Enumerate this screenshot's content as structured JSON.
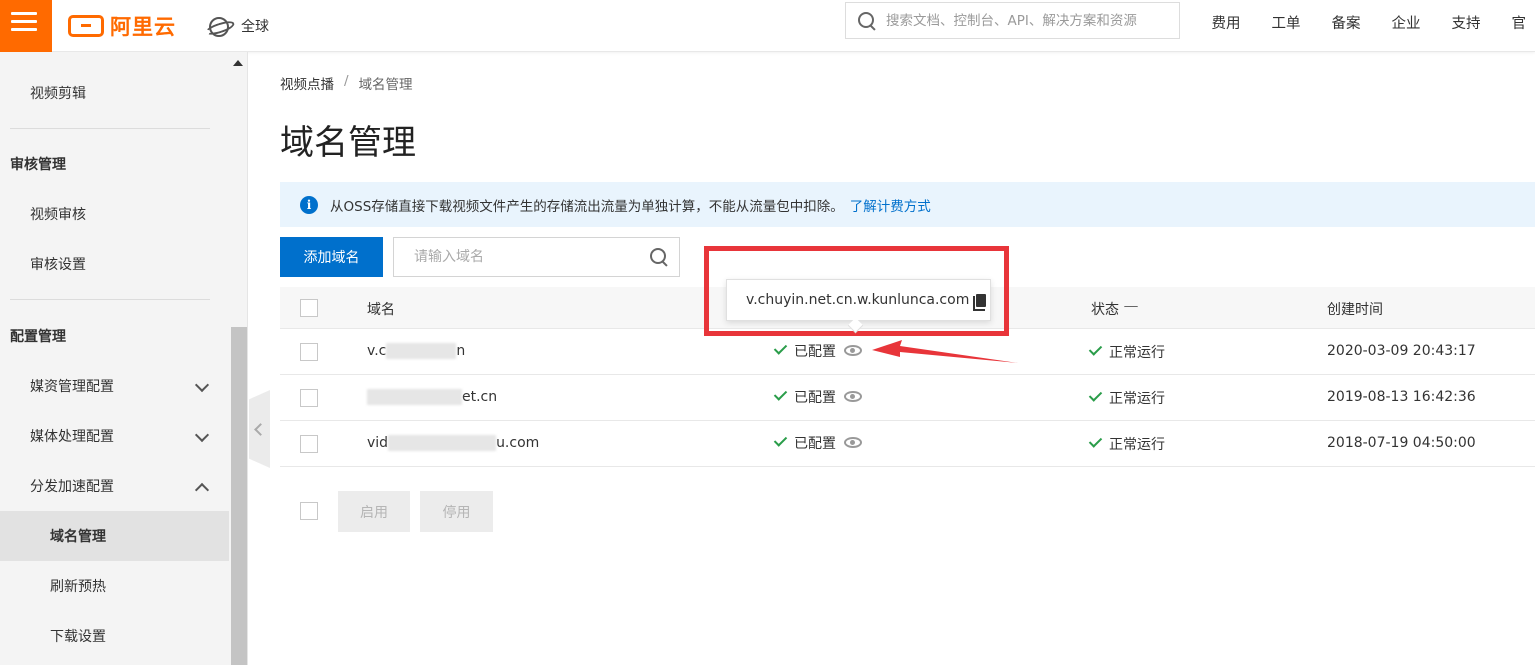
{
  "header": {
    "logo_text": "阿里云",
    "region": "全球",
    "search_placeholder": "搜索文档、控制台、API、解决方案和资源",
    "nav": [
      "费用",
      "工单",
      "备案",
      "企业",
      "支持",
      "官"
    ]
  },
  "sidebar": {
    "items": [
      {
        "label": "视频剪辑",
        "level": 1
      },
      {
        "label": "审核管理",
        "level": 0
      },
      {
        "label": "视频审核",
        "level": 1
      },
      {
        "label": "审核设置",
        "level": 1
      },
      {
        "label": "配置管理",
        "level": 0
      },
      {
        "label": "媒资管理配置",
        "level": 1,
        "expanded": false
      },
      {
        "label": "媒体处理配置",
        "level": 1,
        "expanded": false
      },
      {
        "label": "分发加速配置",
        "level": 1,
        "expanded": true
      },
      {
        "label": "域名管理",
        "level": 2,
        "active": true
      },
      {
        "label": "刷新预热",
        "level": 2
      },
      {
        "label": "下载设置",
        "level": 2
      }
    ]
  },
  "breadcrumb": {
    "parent": "视频点播",
    "separator": "/",
    "current": "域名管理"
  },
  "page_title": "域名管理",
  "notice": {
    "text": "从OSS存储直接下载视频文件产生的存储流出流量为单独计算，不能从流量包中扣除。",
    "link": "了解计费方式"
  },
  "toolbar": {
    "add_label": "添加域名",
    "search_placeholder": "请输入域名"
  },
  "table": {
    "columns": [
      "域名",
      "状态",
      "创建时间"
    ],
    "rows": [
      {
        "domain_prefix": "v.c",
        "domain_suffix": "n",
        "cname": "已配置",
        "status": "正常运行",
        "created": "2020-03-09 20:43:17"
      },
      {
        "domain_prefix": "",
        "domain_suffix": "et.cn",
        "cname": "已配置",
        "status": "正常运行",
        "created": "2019-08-13 16:42:36"
      },
      {
        "domain_prefix": "vid",
        "domain_suffix": "u.com",
        "cname": "已配置",
        "status": "正常运行",
        "created": "2018-07-19 04:50:00"
      }
    ]
  },
  "bulk_actions": {
    "enable": "启用",
    "disable": "停用"
  },
  "tooltip": {
    "cname_value": "v.chuyin.net.cn.w.kunlunca.com"
  },
  "colors": {
    "brand": "#ff6a00",
    "primary": "#0070cc",
    "success": "#2a9d4a",
    "annotation": "#e8353a"
  }
}
